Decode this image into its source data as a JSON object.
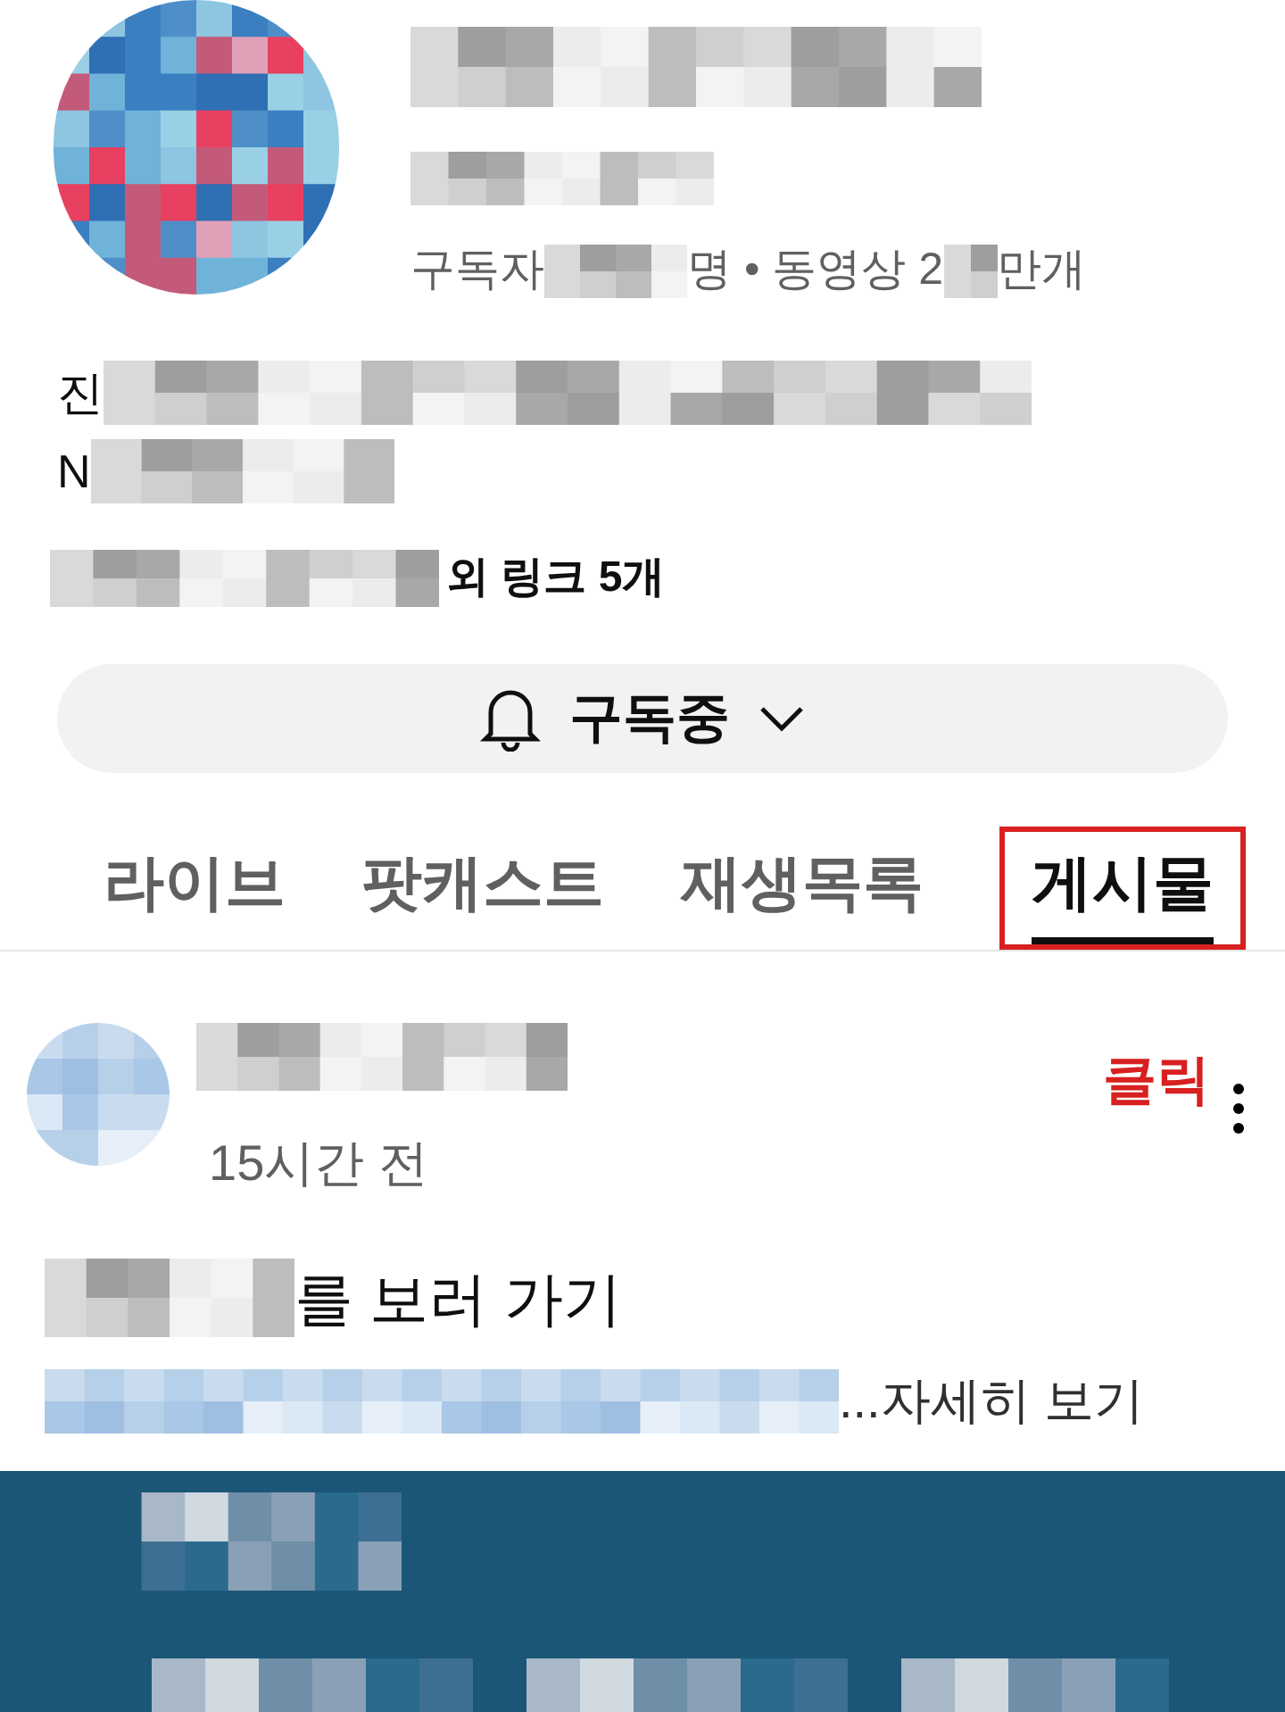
{
  "channel": {
    "subscribers_prefix": "구독자",
    "subscribers_mid": "명 • 동영상 2",
    "videos_suffix": "만개",
    "description_lines": [
      "진",
      "N"
    ],
    "links_suffix": "외 링크 5개"
  },
  "subscribe_button": {
    "label": "구독중"
  },
  "tabs": [
    {
      "label": "라이브",
      "selected": false
    },
    {
      "label": "팟캐스트",
      "selected": false
    },
    {
      "label": "재생목록",
      "selected": false
    },
    {
      "label": "게시물",
      "selected": true
    }
  ],
  "annotation": {
    "label": "클릭"
  },
  "post": {
    "time": "15시간 전",
    "title_suffix": "를 보러 가기",
    "more_link": "...자세히 보기"
  }
}
